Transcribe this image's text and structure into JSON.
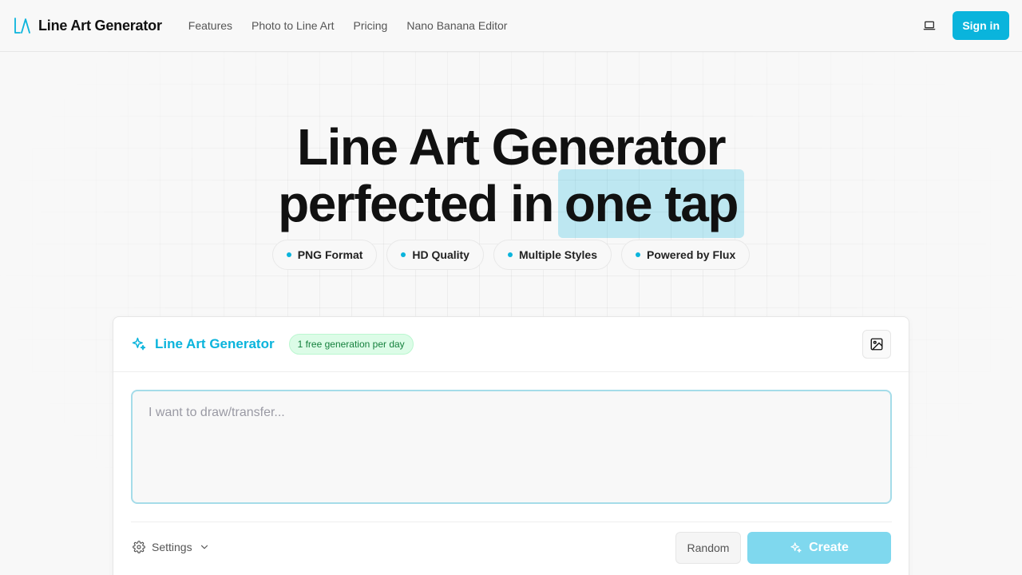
{
  "header": {
    "logo_text": "Line Art Generator",
    "nav": [
      "Features",
      "Photo to Line Art",
      "Pricing",
      "Nano Banana Editor"
    ],
    "signin_label": "Sign in"
  },
  "hero": {
    "title_line1": "Line Art Generator",
    "title_line2": "perfected in",
    "title_highlight": "one tap",
    "pills": [
      "PNG Format",
      "HD Quality",
      "Multiple Styles",
      "Powered by Flux"
    ]
  },
  "card": {
    "title": "Line Art Generator",
    "badge": "1 free generation per day",
    "prompt_placeholder": "I want to draw/transfer...",
    "settings_label": "Settings",
    "random_label": "Random",
    "create_label": "Create"
  },
  "colors": {
    "accent": "#0ab4dc",
    "accent_light": "#7fd8ee",
    "badge_bg": "#dcfce7",
    "badge_text": "#15803d"
  }
}
